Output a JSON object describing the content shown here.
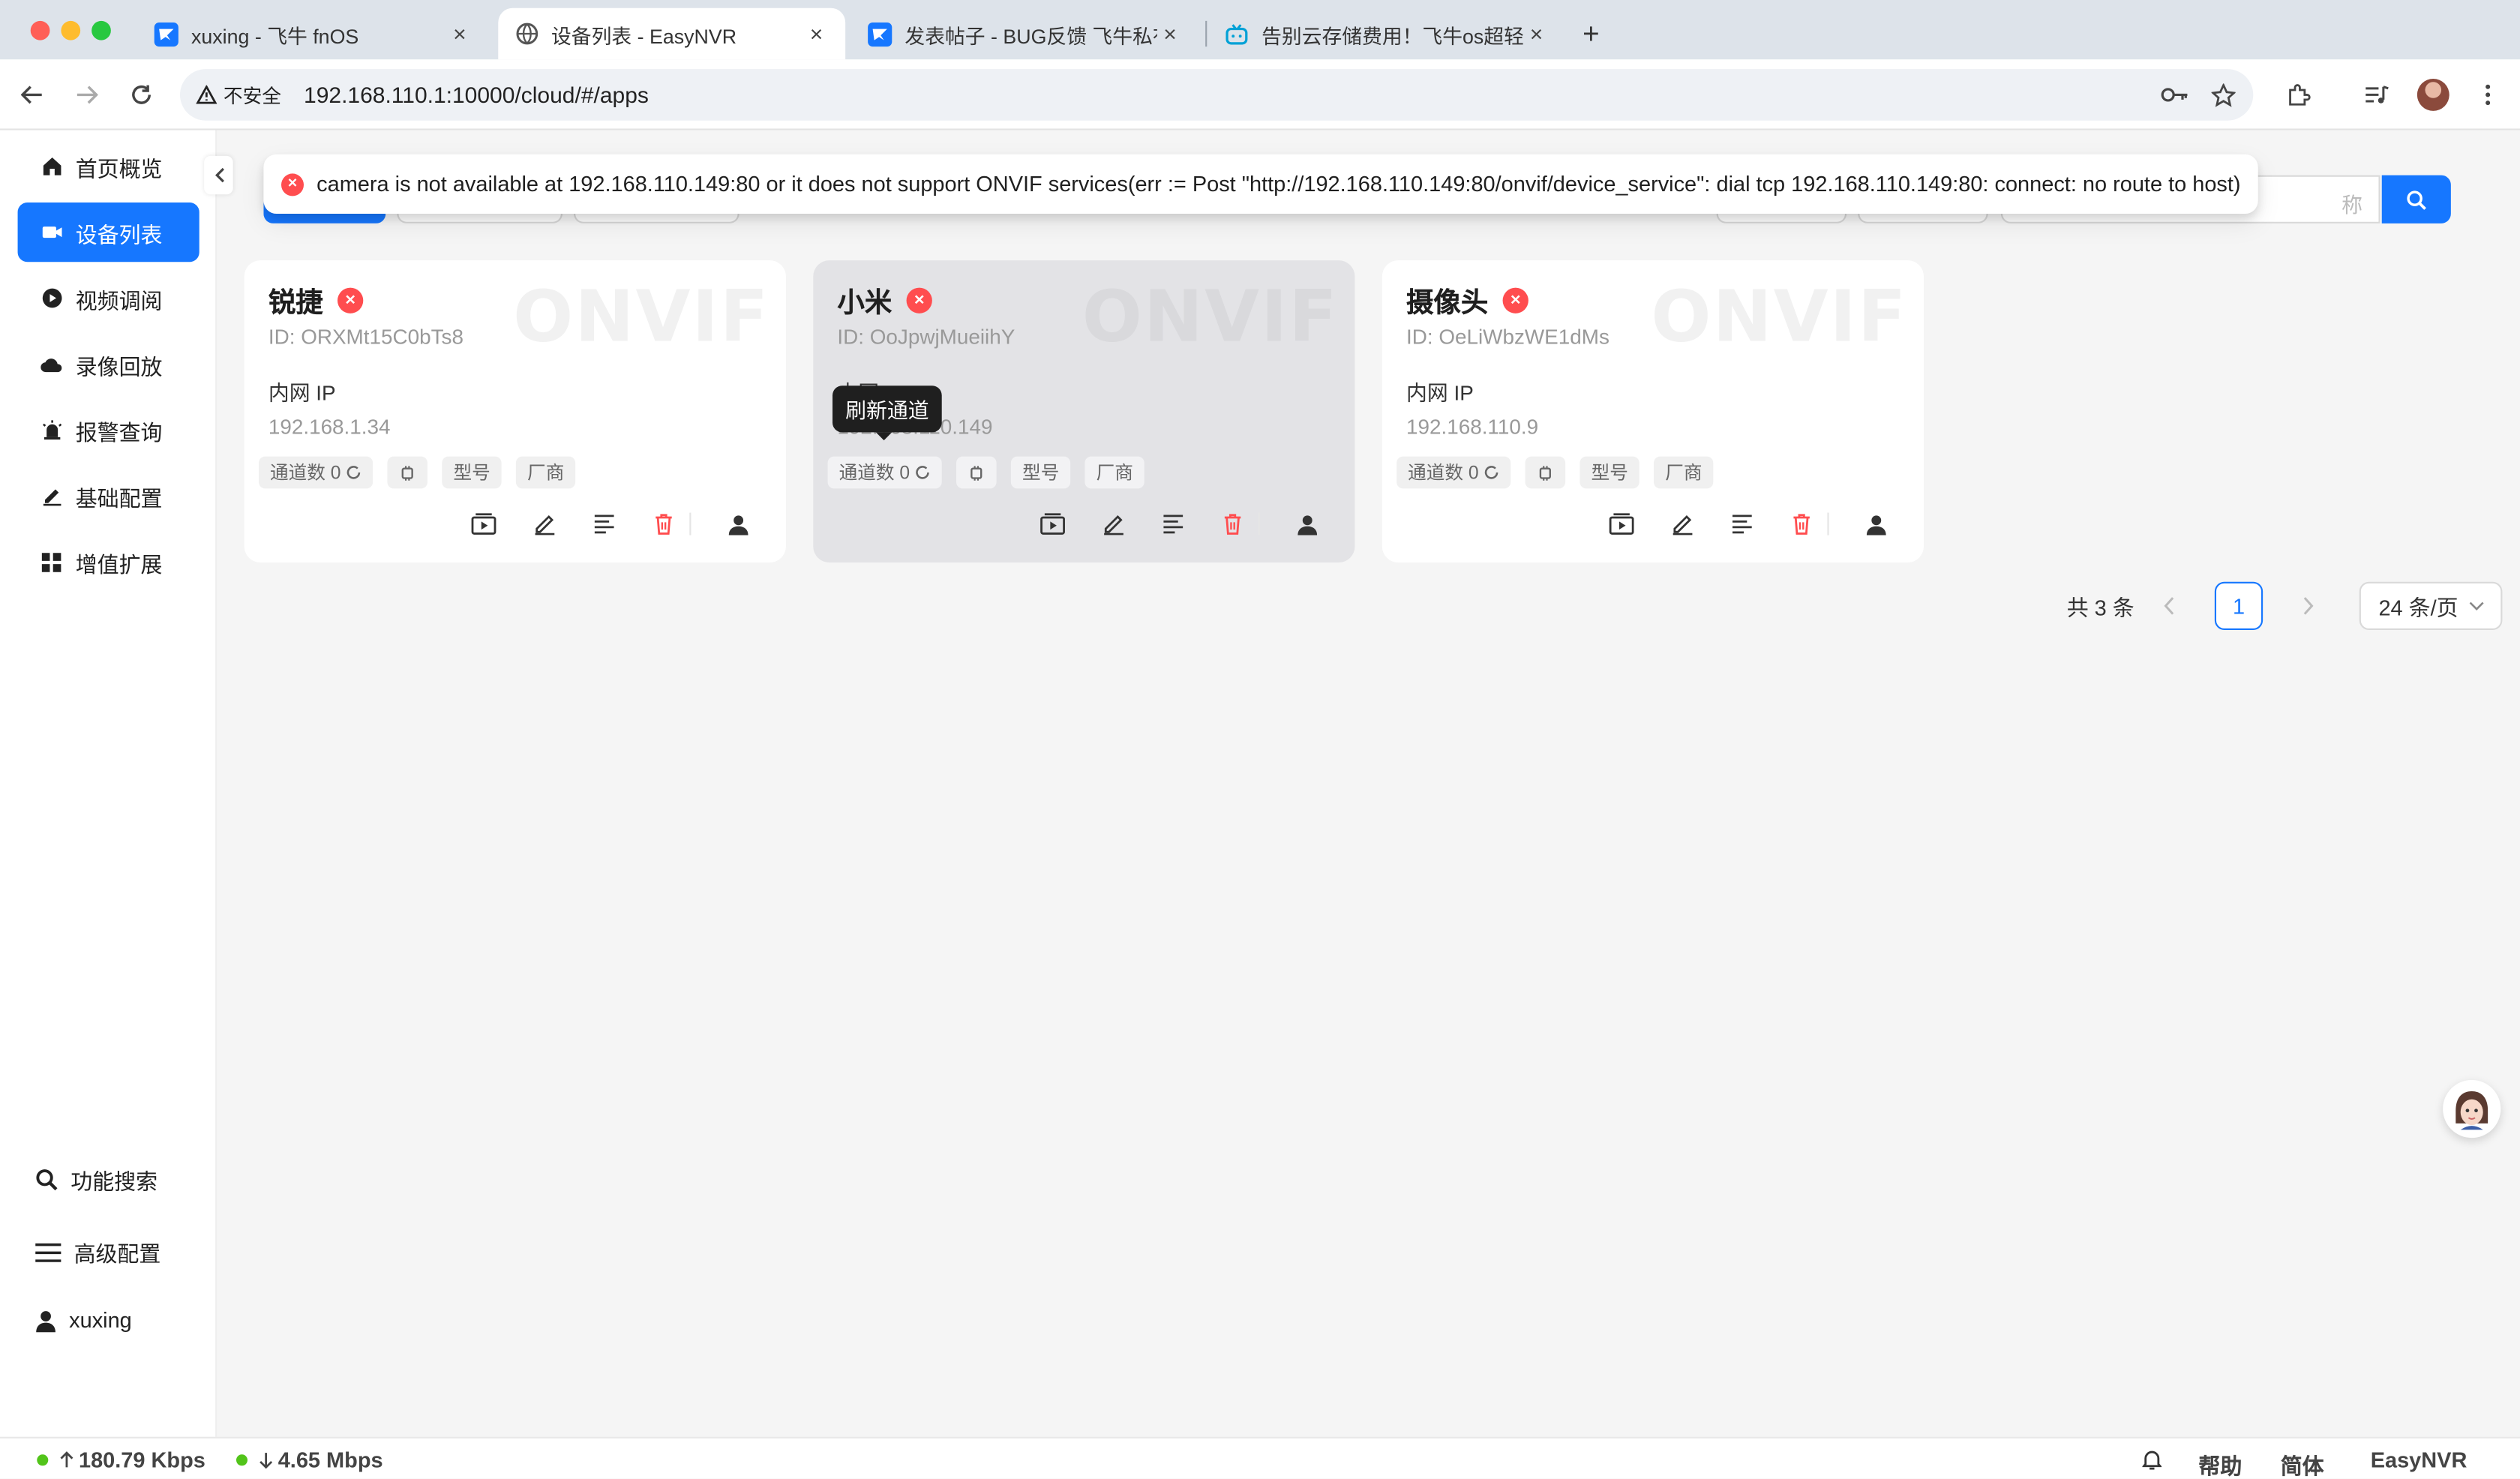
{
  "browser": {
    "tabs": [
      {
        "label": "xuxing - 飞牛 fnOS",
        "icon": "fnos-icon"
      },
      {
        "label": "设备列表 - EasyNVR",
        "icon": "globe-icon"
      },
      {
        "label": "发表帖子 - BUG反馈 飞牛私有云",
        "icon": "fnos-icon"
      },
      {
        "label": "告别云存储费用！飞牛os超轻松",
        "icon": "bilibili-icon"
      }
    ],
    "new_tab": "+",
    "close": "×",
    "security_label": "不安全",
    "url": "192.168.110.1:10000/cloud/#/apps"
  },
  "sidebar": {
    "items": [
      {
        "label": "首页概览",
        "icon": "home-icon"
      },
      {
        "label": "设备列表",
        "icon": "camera-icon"
      },
      {
        "label": "视频调阅",
        "icon": "play-icon"
      },
      {
        "label": "录像回放",
        "icon": "cloud-icon"
      },
      {
        "label": "报警查询",
        "icon": "alarm-icon"
      },
      {
        "label": "基础配置",
        "icon": "edit-icon"
      },
      {
        "label": "增值扩展",
        "icon": "apps-icon"
      }
    ],
    "bottom": [
      {
        "label": "功能搜索",
        "icon": "search-icon"
      },
      {
        "label": "高级配置",
        "icon": "menu-icon"
      },
      {
        "label": "xuxing",
        "icon": "user-icon"
      }
    ]
  },
  "search": {
    "placeholder_tail": "称"
  },
  "alert": {
    "message": "camera is not available at 192.168.110.149:80 or it does not support ONVIF services(err := Post \"http://192.168.110.149:80/onvif/device_service\": dial tcp 192.168.110.149:80: connect: no route to host)"
  },
  "cards": [
    {
      "name": "锐捷",
      "id": "ID: ORXMt15C0bTs8",
      "ip_label": "内网 IP",
      "ip": "192.168.1.34",
      "channels": "通道数 0",
      "model": "型号",
      "vendor": "厂商",
      "watermark": "ONVIF"
    },
    {
      "name": "小米",
      "id": "ID: OoJpwjMueiihY",
      "ip_label": "内网 IP",
      "ip": "192.168.110.149",
      "channels": "通道数 0",
      "model": "型号",
      "vendor": "厂商",
      "watermark": "ONVIF"
    },
    {
      "name": "摄像头",
      "id": "ID: OeLiWbzWE1dMs",
      "ip_label": "内网 IP",
      "ip": "192.168.110.9",
      "channels": "通道数 0",
      "model": "型号",
      "vendor": "厂商",
      "watermark": "ONVIF"
    }
  ],
  "tooltip": "刷新通道",
  "pagination": {
    "total": "共 3 条",
    "current": "1",
    "page_size": "24 条/页"
  },
  "statusbar": {
    "upload": "180.79 Kbps",
    "download": "4.65 Mbps",
    "help": "帮助",
    "lang": "简体",
    "brand": "EasyNVR"
  },
  "colors": {
    "primary": "#1677ff",
    "error": "#ff4d4f",
    "online": "#52c41a"
  }
}
